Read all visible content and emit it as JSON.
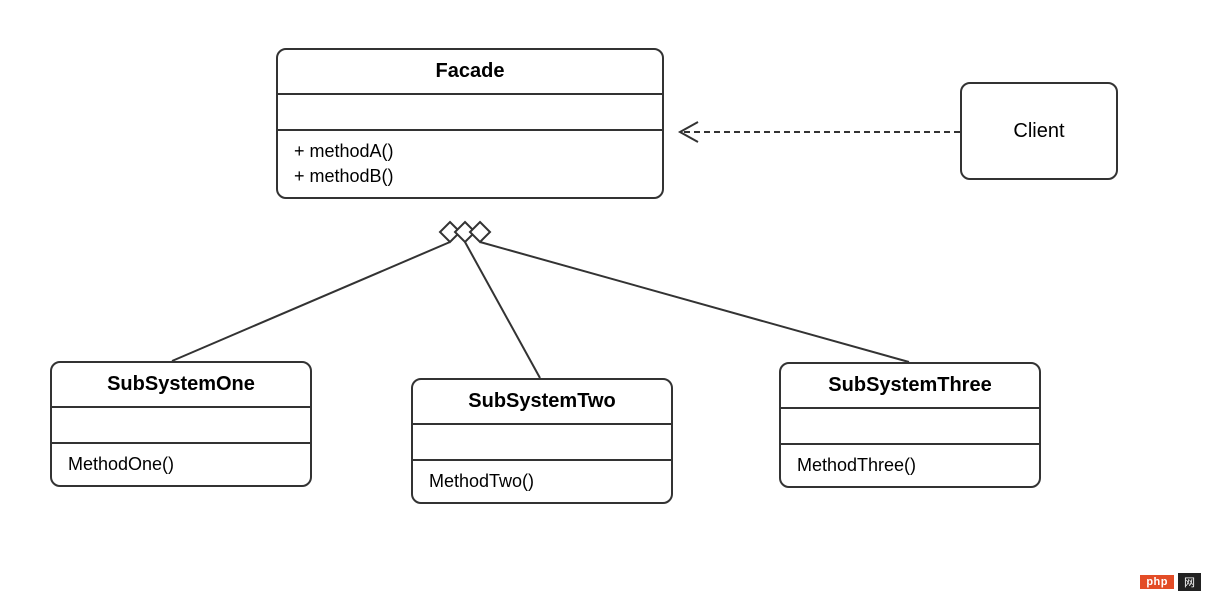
{
  "diagram": {
    "facade": {
      "name": "Facade",
      "methods": [
        "+ methodA()",
        "+ methodB()"
      ]
    },
    "client": {
      "name": "Client"
    },
    "subsystems": [
      {
        "name": "SubSystemOne",
        "method": "MethodOne()"
      },
      {
        "name": "SubSystemTwo",
        "method": "MethodTwo()"
      },
      {
        "name": "SubSystemThree",
        "method": "MethodThree()"
      }
    ]
  },
  "watermark": {
    "left": "php",
    "right": "网"
  }
}
